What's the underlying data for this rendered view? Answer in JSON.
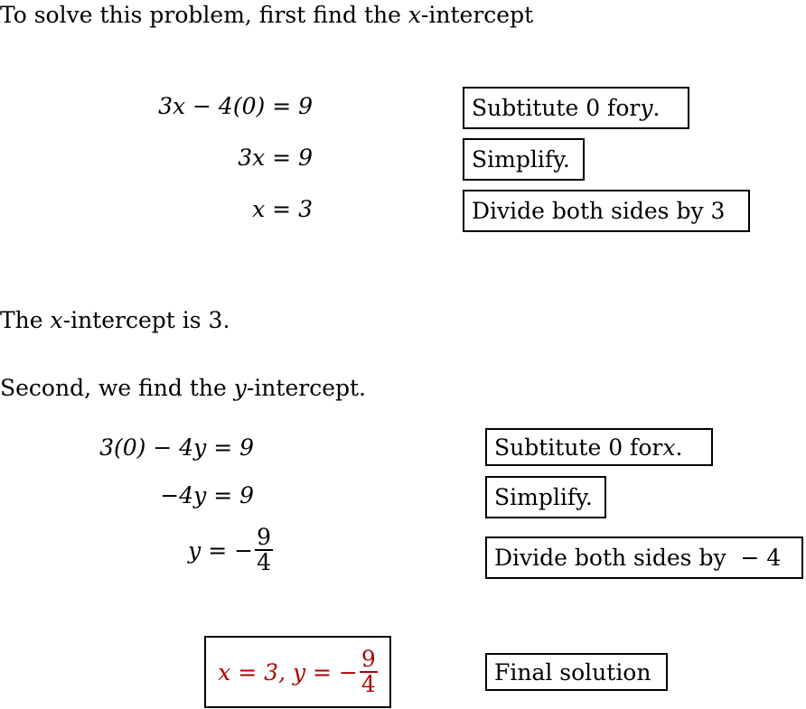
{
  "intro": {
    "text_before": "To solve this problem, first find the ",
    "var": "x",
    "text_after": "-intercept"
  },
  "x_intercept_steps": [
    {
      "lhs": "3x − 4(0) = 9",
      "note_text": "Subtitute 0 for ",
      "note_var": "y",
      "note_end": "."
    },
    {
      "lhs": "3x = 9",
      "note_text": "Simplify.",
      "note_var": "",
      "note_end": ""
    },
    {
      "lhs": "x = 3",
      "note_text": "Divide both sides by 3",
      "note_var": "",
      "note_end": ""
    }
  ],
  "x_result": {
    "text_before": "The ",
    "var": "x",
    "text_after": "-intercept is 3."
  },
  "y_intro": {
    "text_before": "Second, we find the ",
    "var": "y",
    "text_after": "-intercept."
  },
  "y_intercept_steps": [
    {
      "lhs": "3(0) − 4y = 9",
      "note_text": "Subtitute 0 for ",
      "note_var": "x",
      "note_end": "."
    },
    {
      "lhs": "−4y = 9",
      "note_text": "Simplify.",
      "note_var": "",
      "note_end": ""
    },
    {
      "lhs_prefix": "y = −",
      "numerator": "9",
      "denominator": "4",
      "note_text": "Divide both sides by  − 4",
      "note_var": "",
      "note_end": ""
    }
  ],
  "final": {
    "prefix": "x = 3, y = −",
    "numerator": "9",
    "denominator": "4",
    "label": "Final solution",
    "color": "#b00000"
  }
}
